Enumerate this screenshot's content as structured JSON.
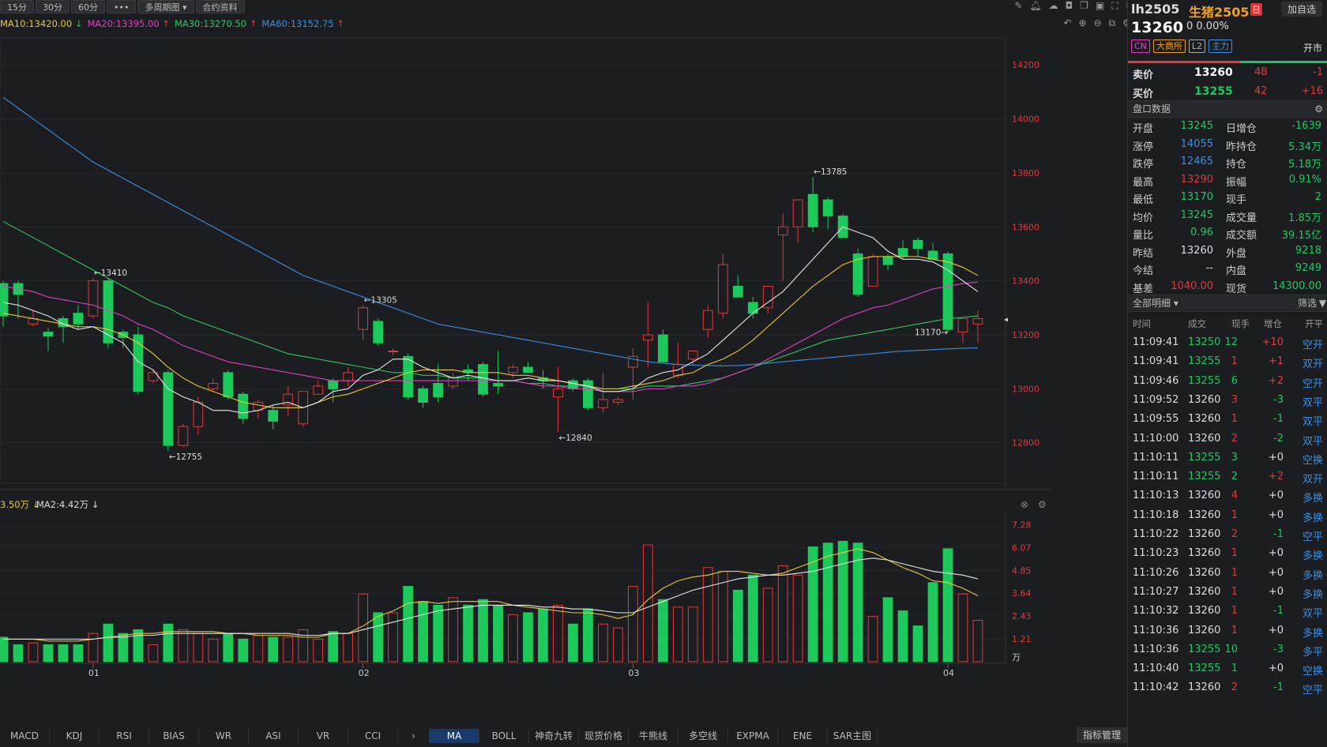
{
  "toolbar": {
    "tabs": [
      "15分",
      "30分",
      "60分",
      "•••",
      "多周期图 ▾",
      "合约资料"
    ]
  },
  "ma_line": [
    {
      "text": "MA10:13420.00",
      "arrow": "↓",
      "color": "#e8c83a"
    },
    {
      "text": "MA20:13395.00",
      "arrow": "↑",
      "color": "#e040c0"
    },
    {
      "text": "MA30:13270.50",
      "arrow": "↑",
      "color": "#2ec95c"
    },
    {
      "text": "MA60:13152.75",
      "arrow": "↑",
      "color": "#3a8fe0"
    }
  ],
  "vol_line": {
    "ma1": "3.50万",
    "ma2": "MA2:4.42万"
  },
  "colors": {
    "up": "#e03a3a",
    "down": "#1ec95c",
    "bg": "#1c1d21",
    "ma5": "#e8e8e8",
    "ma10": "#e8c83a",
    "ma20": "#e040c0",
    "ma30": "#2ec95c",
    "ma60": "#3a8fe0"
  },
  "chart_data": {
    "type": "candlestick",
    "price_ylim": [
      12650,
      14300
    ],
    "price_ticks": [
      "14200",
      "14000",
      "13800",
      "13600",
      "13400",
      "13200",
      "13000",
      "12800"
    ],
    "vol_ylim": [
      0,
      7.8
    ],
    "vol_ticks": [
      "7.28",
      "6.07",
      "4.85",
      "3.64",
      "2.43",
      "1.21"
    ],
    "vol_unit": "万",
    "x_labels": [
      {
        "i": 6,
        "t": "01"
      },
      {
        "i": 24,
        "t": "02"
      },
      {
        "i": 42,
        "t": "03"
      },
      {
        "i": 63,
        "t": "04"
      }
    ],
    "annotations": [
      {
        "i": 6,
        "text": "←13410"
      },
      {
        "i": 11,
        "text": "←12755"
      },
      {
        "i": 24,
        "text": "←13305"
      },
      {
        "i": 37,
        "text": "←12840"
      },
      {
        "i": 54,
        "text": "←13785"
      },
      {
        "i": 63,
        "text": "13170→"
      }
    ],
    "candles": [
      [
        13390,
        13400,
        13230,
        13270,
        1.3
      ],
      [
        13390,
        13400,
        13260,
        13350,
        0.9
      ],
      [
        13240,
        13290,
        13230,
        13260,
        1.0
      ],
      [
        13210,
        13225,
        13140,
        13195,
        0.9
      ],
      [
        13260,
        13270,
        13170,
        13230,
        0.9
      ],
      [
        13280,
        13310,
        13220,
        13240,
        0.9
      ],
      [
        13270,
        13410,
        13260,
        13400,
        1.5
      ],
      [
        13400,
        13410,
        13150,
        13170,
        2.0
      ],
      [
        13210,
        13220,
        13150,
        13190,
        1.5
      ],
      [
        13200,
        13230,
        12980,
        12990,
        1.7
      ],
      [
        13030,
        13070,
        13020,
        13060,
        0.9
      ],
      [
        13060,
        13070,
        12770,
        12790,
        2.0
      ],
      [
        12790,
        12870,
        12785,
        12860,
        1.7
      ],
      [
        12860,
        12970,
        12830,
        12950,
        1.5
      ],
      [
        13000,
        13040,
        12990,
        13020,
        1.2
      ],
      [
        13060,
        13070,
        12960,
        12970,
        1.5
      ],
      [
        12980,
        12990,
        12870,
        12890,
        1.2
      ],
      [
        12920,
        12960,
        12890,
        12950,
        1.4
      ],
      [
        12920,
        12940,
        12850,
        12880,
        1.3
      ],
      [
        12940,
        13010,
        12900,
        12980,
        1.3
      ],
      [
        12870,
        12990,
        12860,
        12990,
        1.7
      ],
      [
        12980,
        13030,
        12980,
        13010,
        1.2
      ],
      [
        13030,
        13040,
        12950,
        13000,
        1.6
      ],
      [
        13030,
        13080,
        13010,
        13060,
        1.5
      ],
      [
        13220,
        13310,
        13180,
        13300,
        3.6
      ],
      [
        13250,
        13260,
        13160,
        13170,
        2.6
      ],
      [
        13140,
        13150,
        13125,
        13140,
        2.6
      ],
      [
        13120,
        13130,
        12960,
        12970,
        4.0
      ],
      [
        13000,
        13010,
        12930,
        12950,
        3.2
      ],
      [
        13020,
        13090,
        12950,
        12970,
        3.0
      ],
      [
        13010,
        13060,
        13000,
        13040,
        3.4
      ],
      [
        13070,
        13090,
        13030,
        13060,
        3.0
      ],
      [
        13090,
        13100,
        12970,
        12980,
        3.3
      ],
      [
        13020,
        13140,
        12980,
        13010,
        3.0
      ],
      [
        13060,
        13090,
        13040,
        13080,
        2.5
      ],
      [
        13080,
        13100,
        13060,
        13060,
        2.6
      ],
      [
        13040,
        13070,
        13000,
        13030,
        2.8
      ],
      [
        12970,
        13080,
        12840,
        13000,
        3.0
      ],
      [
        13030,
        13040,
        12990,
        13000,
        2.0
      ],
      [
        13030,
        13040,
        12920,
        12930,
        2.8
      ],
      [
        12930,
        13060,
        12910,
        12960,
        2.0
      ],
      [
        12950,
        12970,
        12940,
        12960,
        1.8
      ],
      [
        13080,
        13150,
        12960,
        13120,
        4.0
      ],
      [
        13180,
        13320,
        13080,
        13200,
        6.2
      ],
      [
        13200,
        13220,
        13100,
        13100,
        3.3
      ],
      [
        13050,
        13170,
        13040,
        13090,
        2.9
      ],
      [
        13110,
        13130,
        13090,
        13140,
        2.9
      ],
      [
        13220,
        13310,
        13190,
        13290,
        5.0
      ],
      [
        13280,
        13500,
        13260,
        13460,
        4.8
      ],
      [
        13380,
        13420,
        13360,
        13340,
        3.8
      ],
      [
        13320,
        13340,
        13260,
        13280,
        4.6
      ],
      [
        13300,
        13370,
        13280,
        13380,
        3.9
      ],
      [
        13570,
        13650,
        13400,
        13600,
        5.1
      ],
      [
        13600,
        13700,
        13540,
        13700,
        4.6
      ],
      [
        13720,
        13785,
        13580,
        13600,
        6.1
      ],
      [
        13700,
        13710,
        13590,
        13640,
        6.3
      ],
      [
        13640,
        13650,
        13560,
        13560,
        6.4
      ],
      [
        13500,
        13520,
        13340,
        13350,
        6.3
      ],
      [
        13380,
        13500,
        13380,
        13490,
        2.4
      ],
      [
        13490,
        13500,
        13440,
        13460,
        3.4
      ],
      [
        13520,
        13550,
        13480,
        13490,
        2.7
      ],
      [
        13550,
        13560,
        13490,
        13520,
        1.9
      ],
      [
        13510,
        13540,
        13480,
        13480,
        4.2
      ],
      [
        13500,
        13510,
        13210,
        13220,
        6.0
      ],
      [
        13210,
        13230,
        13170,
        13260,
        3.6
      ],
      [
        13240,
        13290,
        13170,
        13260,
        2.2
      ]
    ],
    "ma5": [
      13320,
      13310,
      13290,
      13270,
      13240,
      13220,
      13230,
      13200,
      13170,
      13100,
      13070,
      13000,
      12970,
      12950,
      12920,
      12920,
      12910,
      12920,
      12940,
      12950,
      12930,
      12950,
      12990,
      13000,
      13050,
      13070,
      13110,
      13110,
      13080,
      13060,
      13040,
      13050,
      13040,
      13030,
      13030,
      13040,
      13030,
      13030,
      13020,
      13010,
      12990,
      12990,
      13000,
      13040,
      13060,
      13070,
      13100,
      13130,
      13180,
      13230,
      13280,
      13320,
      13360,
      13420,
      13480,
      13540,
      13600,
      13580,
      13560,
      13510,
      13480,
      13480,
      13470,
      13440,
      13400,
      13360
    ],
    "ma10": [
      13280,
      13270,
      13260,
      13250,
      13240,
      13230,
      13230,
      13220,
      13200,
      13170,
      13130,
      13080,
      13040,
      13010,
      12990,
      12970,
      12950,
      12940,
      12930,
      12930,
      12930,
      12950,
      12970,
      12980,
      13000,
      13020,
      13040,
      13060,
      13070,
      13070,
      13070,
      13060,
      13060,
      13060,
      13050,
      13050,
      13040,
      13030,
      13020,
      13010,
      13000,
      13000,
      13010,
      13020,
      13030,
      13050,
      13060,
      13090,
      13110,
      13140,
      13180,
      13230,
      13280,
      13330,
      13380,
      13420,
      13460,
      13480,
      13490,
      13490,
      13490,
      13490,
      13480,
      13470,
      13450,
      13420
    ],
    "ma20": [
      13380,
      13370,
      13360,
      13340,
      13330,
      13320,
      13310,
      13290,
      13270,
      13240,
      13220,
      13190,
      13160,
      13140,
      13120,
      13100,
      13090,
      13080,
      13070,
      13060,
      13050,
      13040,
      13030,
      13030,
      13030,
      13030,
      13030,
      13030,
      13030,
      13030,
      13030,
      13030,
      13030,
      13030,
      13030,
      13020,
      13010,
      13010,
      13000,
      13000,
      12990,
      12990,
      12990,
      13000,
      13000,
      13010,
      13010,
      13020,
      13040,
      13060,
      13080,
      13110,
      13140,
      13170,
      13200,
      13230,
      13260,
      13280,
      13300,
      13310,
      13330,
      13350,
      13370,
      13380,
      13390,
      13395
    ],
    "ma30": [
      13620,
      13590,
      13560,
      13530,
      13500,
      13470,
      13440,
      13410,
      13380,
      13350,
      13320,
      13300,
      13270,
      13250,
      13230,
      13210,
      13190,
      13170,
      13150,
      13130,
      13120,
      13110,
      13100,
      13090,
      13080,
      13070,
      13060,
      13060,
      13050,
      13050,
      13040,
      13040,
      13040,
      13030,
      13030,
      13020,
      13020,
      13010,
      13010,
      13010,
      13000,
      13000,
      13000,
      13010,
      13010,
      13010,
      13020,
      13030,
      13040,
      13060,
      13080,
      13100,
      13120,
      13140,
      13160,
      13180,
      13190,
      13200,
      13210,
      13220,
      13230,
      13240,
      13250,
      13260,
      13265,
      13270
    ],
    "ma60": [
      14080,
      14040,
      14000,
      13960,
      13920,
      13880,
      13840,
      13810,
      13780,
      13750,
      13720,
      13690,
      13660,
      13630,
      13600,
      13570,
      13540,
      13510,
      13480,
      13450,
      13420,
      13400,
      13380,
      13360,
      13340,
      13320,
      13300,
      13280,
      13260,
      13240,
      13230,
      13220,
      13210,
      13200,
      13190,
      13180,
      13170,
      13160,
      13150,
      13140,
      13130,
      13120,
      13110,
      13100,
      13095,
      13090,
      13088,
      13086,
      13085,
      13086,
      13090,
      13095,
      13100,
      13105,
      13110,
      13115,
      13120,
      13125,
      13130,
      13135,
      13140,
      13142,
      13145,
      13148,
      13150,
      13152
    ],
    "vol_ma1": [
      1.2,
      1.2,
      1.2,
      1.1,
      1.1,
      1.1,
      1.2,
      1.3,
      1.4,
      1.5,
      1.5,
      1.6,
      1.6,
      1.6,
      1.6,
      1.5,
      1.5,
      1.4,
      1.4,
      1.4,
      1.3,
      1.3,
      1.5,
      1.5,
      1.9,
      2.4,
      2.7,
      3.1,
      3.2,
      3.1,
      3.2,
      3.2,
      3.2,
      3.2,
      3.0,
      2.9,
      2.8,
      2.7,
      2.6,
      2.6,
      2.5,
      2.3,
      2.5,
      3.3,
      3.9,
      4.3,
      4.5,
      4.6,
      4.8,
      4.8,
      4.7,
      4.6,
      4.7,
      5.0,
      5.3,
      5.6,
      5.8,
      6.0,
      5.8,
      5.4,
      5.0,
      4.7,
      4.3,
      4.2,
      3.9,
      3.5
    ],
    "vol_ma2": [
      1.2,
      1.2,
      1.2,
      1.2,
      1.2,
      1.2,
      1.2,
      1.3,
      1.3,
      1.4,
      1.4,
      1.5,
      1.5,
      1.5,
      1.5,
      1.5,
      1.5,
      1.5,
      1.5,
      1.5,
      1.4,
      1.4,
      1.5,
      1.5,
      1.7,
      1.9,
      2.1,
      2.3,
      2.5,
      2.7,
      2.8,
      2.9,
      3.0,
      3.0,
      3.0,
      3.0,
      2.9,
      2.9,
      2.8,
      2.8,
      2.7,
      2.6,
      2.6,
      2.9,
      3.2,
      3.5,
      3.8,
      4.0,
      4.2,
      4.4,
      4.5,
      4.6,
      4.6,
      4.7,
      4.8,
      5.0,
      5.2,
      5.4,
      5.5,
      5.4,
      5.2,
      5.0,
      4.8,
      4.7,
      4.6,
      4.4
    ]
  },
  "bottom_tabs": [
    "MACD",
    "KDJ",
    "RSI",
    "BIAS",
    "WR",
    "ASI",
    "VR",
    "CCI",
    "›",
    "MA",
    "BOLL",
    "神奇九转",
    "现货价格",
    "牛熊线",
    "多空线",
    "EXPMA",
    "ENE",
    "SAR主图"
  ],
  "indicator_mgr": "指标管理",
  "side": {
    "symbol": "lh2505",
    "name": "生猪2505",
    "flag": "日",
    "add": "加自选",
    "price": "13260",
    "change": "0 0.00%",
    "badges": [
      {
        "t": "CN",
        "c": "#e040c0"
      },
      {
        "t": "大商所",
        "c": "#f0a020"
      },
      {
        "t": "L2",
        "c": "#aaa"
      },
      {
        "t": "主力",
        "c": "#3a8fe0"
      }
    ],
    "status": "开市",
    "ask": {
      "label": "卖价",
      "price": "13260",
      "vol": "48",
      "diff": "-1"
    },
    "bid": {
      "label": "买价",
      "price": "13255",
      "vol": "42",
      "diff": "+16"
    },
    "panel_title": "盘口数据",
    "stats": [
      {
        "l1": "开盘",
        "v1": "13245",
        "c1": "dn",
        "l2": "日增仓",
        "v2": "-1639",
        "c2": "dn"
      },
      {
        "l1": "涨停",
        "v1": "14055",
        "c1": "bl",
        "l2": "昨持仓",
        "v2": "5.34万",
        "c2": "dn"
      },
      {
        "l1": "跌停",
        "v1": "12465",
        "c1": "bl",
        "l2": "持仓",
        "v2": "5.18万",
        "c2": "dn"
      },
      {
        "l1": "最高",
        "v1": "13290",
        "c1": "up",
        "l2": "振幅",
        "v2": "0.91%",
        "c2": "dn"
      },
      {
        "l1": "最低",
        "v1": "13170",
        "c1": "dn",
        "l2": "现手",
        "v2": "2",
        "c2": "dn"
      },
      {
        "l1": "均价",
        "v1": "13245",
        "c1": "dn",
        "l2": "成交量",
        "v2": "1.85万",
        "c2": "dn"
      },
      {
        "l1": "量比",
        "v1": "0.96",
        "c1": "dn",
        "l2": "成交额",
        "v2": "39.15亿",
        "c2": "dn"
      },
      {
        "l1": "昨结",
        "v1": "13260",
        "c1": "",
        "l2": "外盘",
        "v2": "9218",
        "c2": "dn"
      },
      {
        "l1": "今结",
        "v1": "--",
        "c1": "",
        "l2": "内盘",
        "v2": "9249",
        "c2": "dn"
      },
      {
        "l1": "基差",
        "v1": "1040.00",
        "c1": "up",
        "l2": "现货",
        "v2": "14300.00",
        "c2": "dn"
      }
    ],
    "detail_title": "全部明细 ▾",
    "filter": "筛选",
    "cols": [
      "时间",
      "成交",
      "现手",
      "增仓",
      "开平"
    ],
    "ticks": [
      [
        "11:09:41",
        "13250",
        "12",
        "+10",
        "空开",
        "dn",
        "dn",
        "up",
        "bl"
      ],
      [
        "11:09:41",
        "13255",
        "1",
        "+1",
        "双开",
        "dn",
        "up",
        "up",
        "bl"
      ],
      [
        "11:09:46",
        "13255",
        "6",
        "+2",
        "空开",
        "dn",
        "dn",
        "up",
        "bl"
      ],
      [
        "11:09:52",
        "13260",
        "3",
        "-3",
        "双平",
        "",
        "up",
        "dn",
        "bl"
      ],
      [
        "11:09:55",
        "13260",
        "1",
        "-1",
        "双平",
        "",
        "up",
        "dn",
        "bl"
      ],
      [
        "11:10:00",
        "13260",
        "2",
        "-2",
        "双平",
        "",
        "up",
        "dn",
        "bl"
      ],
      [
        "11:10:11",
        "13255",
        "3",
        "+0",
        "空换",
        "dn",
        "dn",
        "",
        "bl"
      ],
      [
        "11:10:11",
        "13255",
        "2",
        "+2",
        "双开",
        "dn",
        "dn",
        "up",
        "bl"
      ],
      [
        "11:10:13",
        "13260",
        "4",
        "+0",
        "多换",
        "",
        "up",
        "",
        "bl"
      ],
      [
        "11:10:18",
        "13260",
        "1",
        "+0",
        "多换",
        "",
        "up",
        "",
        "bl"
      ],
      [
        "11:10:22",
        "13260",
        "2",
        "-1",
        "空平",
        "",
        "up",
        "dn",
        "bl"
      ],
      [
        "11:10:23",
        "13260",
        "1",
        "+0",
        "多换",
        "",
        "up",
        "",
        "bl"
      ],
      [
        "11:10:26",
        "13260",
        "1",
        "+0",
        "多换",
        "",
        "up",
        "",
        "bl"
      ],
      [
        "11:10:27",
        "13260",
        "1",
        "+0",
        "多换",
        "",
        "up",
        "",
        "bl"
      ],
      [
        "11:10:32",
        "13260",
        "1",
        "-1",
        "双平",
        "",
        "up",
        "dn",
        "bl"
      ],
      [
        "11:10:36",
        "13260",
        "1",
        "+0",
        "多换",
        "",
        "up",
        "",
        "bl"
      ],
      [
        "11:10:36",
        "13255",
        "10",
        "-3",
        "多平",
        "dn",
        "dn",
        "dn",
        "bl"
      ],
      [
        "11:10:40",
        "13255",
        "1",
        "+0",
        "空换",
        "dn",
        "dn",
        "",
        "bl"
      ],
      [
        "11:10:42",
        "13260",
        "2",
        "-1",
        "空平",
        "",
        "up",
        "dn",
        "bl"
      ]
    ]
  }
}
